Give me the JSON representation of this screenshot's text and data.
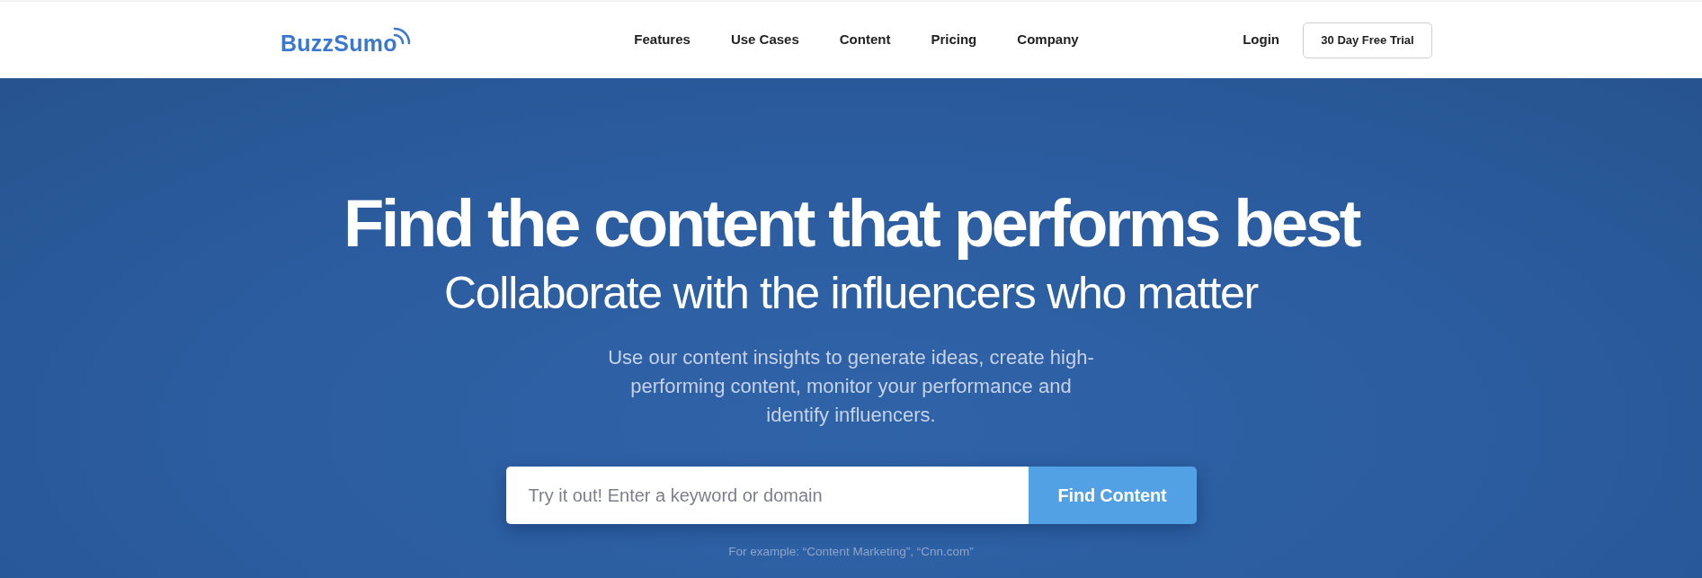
{
  "header": {
    "logo": "BuzzSumo",
    "nav": [
      "Features",
      "Use Cases",
      "Content",
      "Pricing",
      "Company"
    ],
    "login": "Login",
    "trial_button": "30 Day Free Trial"
  },
  "hero": {
    "title": "Find the content that performs best",
    "subtitle": "Collaborate with the influencers who matter",
    "description": "Use our content insights to generate ideas, create high-performing content, monitor your performance and identify influencers.",
    "search": {
      "placeholder": "Try it out! Enter a keyword or domain",
      "button": "Find Content"
    },
    "example": "For example: “Content Marketing”, “Cnn.com”"
  }
}
